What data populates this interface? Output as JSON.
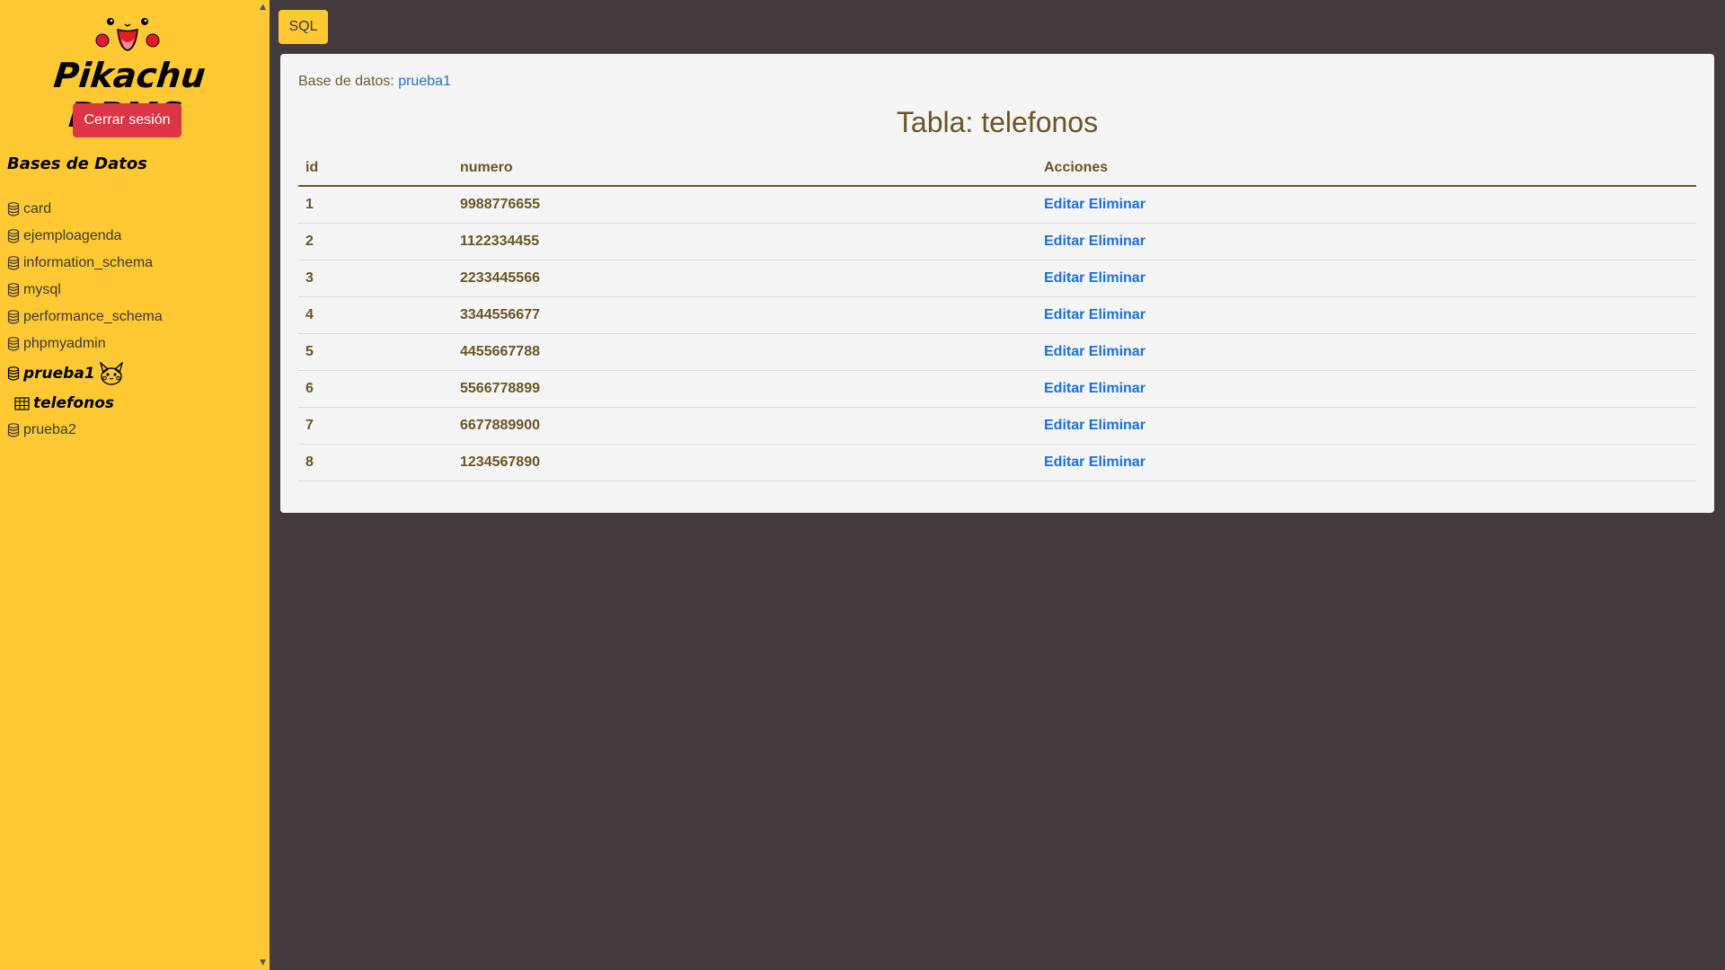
{
  "app": {
    "logo_text": "Pikachu DBMS",
    "logout_label": "Cerrar sesión",
    "sql_label": "SQL",
    "accent_color": "#ffc933",
    "danger_color": "#dc3545",
    "link_color": "#1a6fdc"
  },
  "sidebar": {
    "section_title": "Bases de Datos",
    "databases": [
      {
        "name": "card"
      },
      {
        "name": "ejemploagenda"
      },
      {
        "name": "information_schema"
      },
      {
        "name": "mysql"
      },
      {
        "name": "performance_schema"
      },
      {
        "name": "phpmyadmin"
      },
      {
        "name": "prueba1",
        "active": true,
        "tables": [
          {
            "name": "telefonos"
          }
        ]
      },
      {
        "name": "prueba2"
      }
    ]
  },
  "main": {
    "db_label": "Base de datos:",
    "db_name": "prueba1",
    "table_title": "Tabla: telefonos",
    "columns": [
      "id",
      "numero",
      "Acciones"
    ],
    "rows": [
      {
        "id": "1",
        "numero": "9988776655"
      },
      {
        "id": "2",
        "numero": "1122334455"
      },
      {
        "id": "3",
        "numero": "2233445566"
      },
      {
        "id": "4",
        "numero": "3344556677"
      },
      {
        "id": "5",
        "numero": "4455667788"
      },
      {
        "id": "6",
        "numero": "5566778899"
      },
      {
        "id": "7",
        "numero": "6677889900"
      },
      {
        "id": "8",
        "numero": "1234567890"
      }
    ],
    "edit_label": "Editar",
    "delete_label": "Eliminar"
  }
}
